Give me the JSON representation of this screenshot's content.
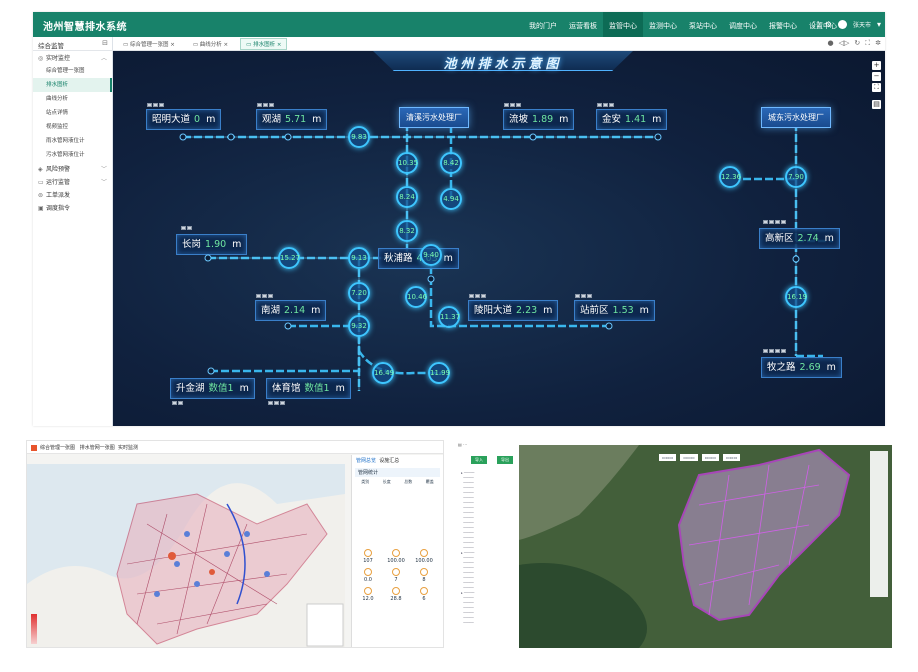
{
  "app": {
    "title": "池州智慧排水系统"
  },
  "nav": {
    "items": [
      "我的门户",
      "运营看板",
      "监管中心",
      "监测中心",
      "泵站中心",
      "调度中心",
      "报警中心",
      "设置中心"
    ],
    "active_index": 2
  },
  "user": {
    "name": "张天市"
  },
  "sidebar": {
    "header": "综合监管",
    "groups": [
      {
        "label": "实时监控",
        "items": [
          "综合管理一张图",
          "排水图析",
          "曲线分析",
          "站点详情",
          "视频监控",
          "雨水管网液位计",
          "污水管网液位计"
        ],
        "active_item": 1
      },
      {
        "label": "风险预警"
      },
      {
        "label": "运行监管"
      },
      {
        "label": "工单派发"
      },
      {
        "label": "调度指令"
      }
    ]
  },
  "tabs": [
    "综合管理一张图",
    "曲线分析",
    "排水图析"
  ],
  "active_tab": 2,
  "diagram": {
    "title": "池州排水示意图",
    "plants": {
      "qingxi": "清溪污水处理厂",
      "chengdong": "城东污水处理厂"
    },
    "unit": "m",
    "stations": {
      "zhaoming": {
        "name": "昭明大道",
        "value": "0"
      },
      "guanhu": {
        "name": "观湖",
        "value": "5.71"
      },
      "liupo": {
        "name": "流坡",
        "value": "1.89"
      },
      "jinan": {
        "name": "金安",
        "value": "1.41"
      },
      "changgang": {
        "name": "长岗",
        "value": "1.90"
      },
      "qiupu": {
        "name": "秋浦路",
        "value": "4.03"
      },
      "nanhu": {
        "name": "南湖",
        "value": "2.14"
      },
      "lingyang": {
        "name": "陵阳大道",
        "value": "2.23"
      },
      "zhanqian": {
        "name": "站前区",
        "value": "1.53"
      },
      "gaoxin": {
        "name": "高新区",
        "value": "2.74"
      },
      "muzhi": {
        "name": "牧之路",
        "value": "2.69"
      },
      "shengjinhu": {
        "name": "升金湖",
        "value": "数值1"
      },
      "tiyuguan": {
        "name": "体育馆",
        "value": "数值1"
      }
    },
    "nodes": [
      "9.83",
      "10.35",
      "8.42",
      "8.24",
      "4.94",
      "8.32",
      "9.40",
      "15.27",
      "9.13",
      "7.20",
      "10.46",
      "11.37",
      "9.32",
      "16.49",
      "11.99",
      "12.36",
      "7.90",
      "16.19"
    ]
  },
  "shot2": {
    "title": "综合管理一张图",
    "tabs": [
      "排水管网一张图",
      "实时监测"
    ],
    "panel": {
      "tabs": [
        "管网总览",
        "设施汇总"
      ],
      "section": "管网统计",
      "table_head": [
        "类别",
        "长度",
        "总数",
        "覆盖"
      ],
      "stats": [
        "107",
        "100.00",
        "100.00",
        "0.0",
        "7",
        "8",
        "12.0",
        "28.8",
        "6"
      ]
    }
  },
  "shot3": {
    "btns": [
      "导入",
      "导出"
    ]
  },
  "colors": {
    "brand": "#18826a",
    "canvas": "#10213e",
    "value": "#6fe6a2",
    "pipe": "#3ec6ff"
  }
}
